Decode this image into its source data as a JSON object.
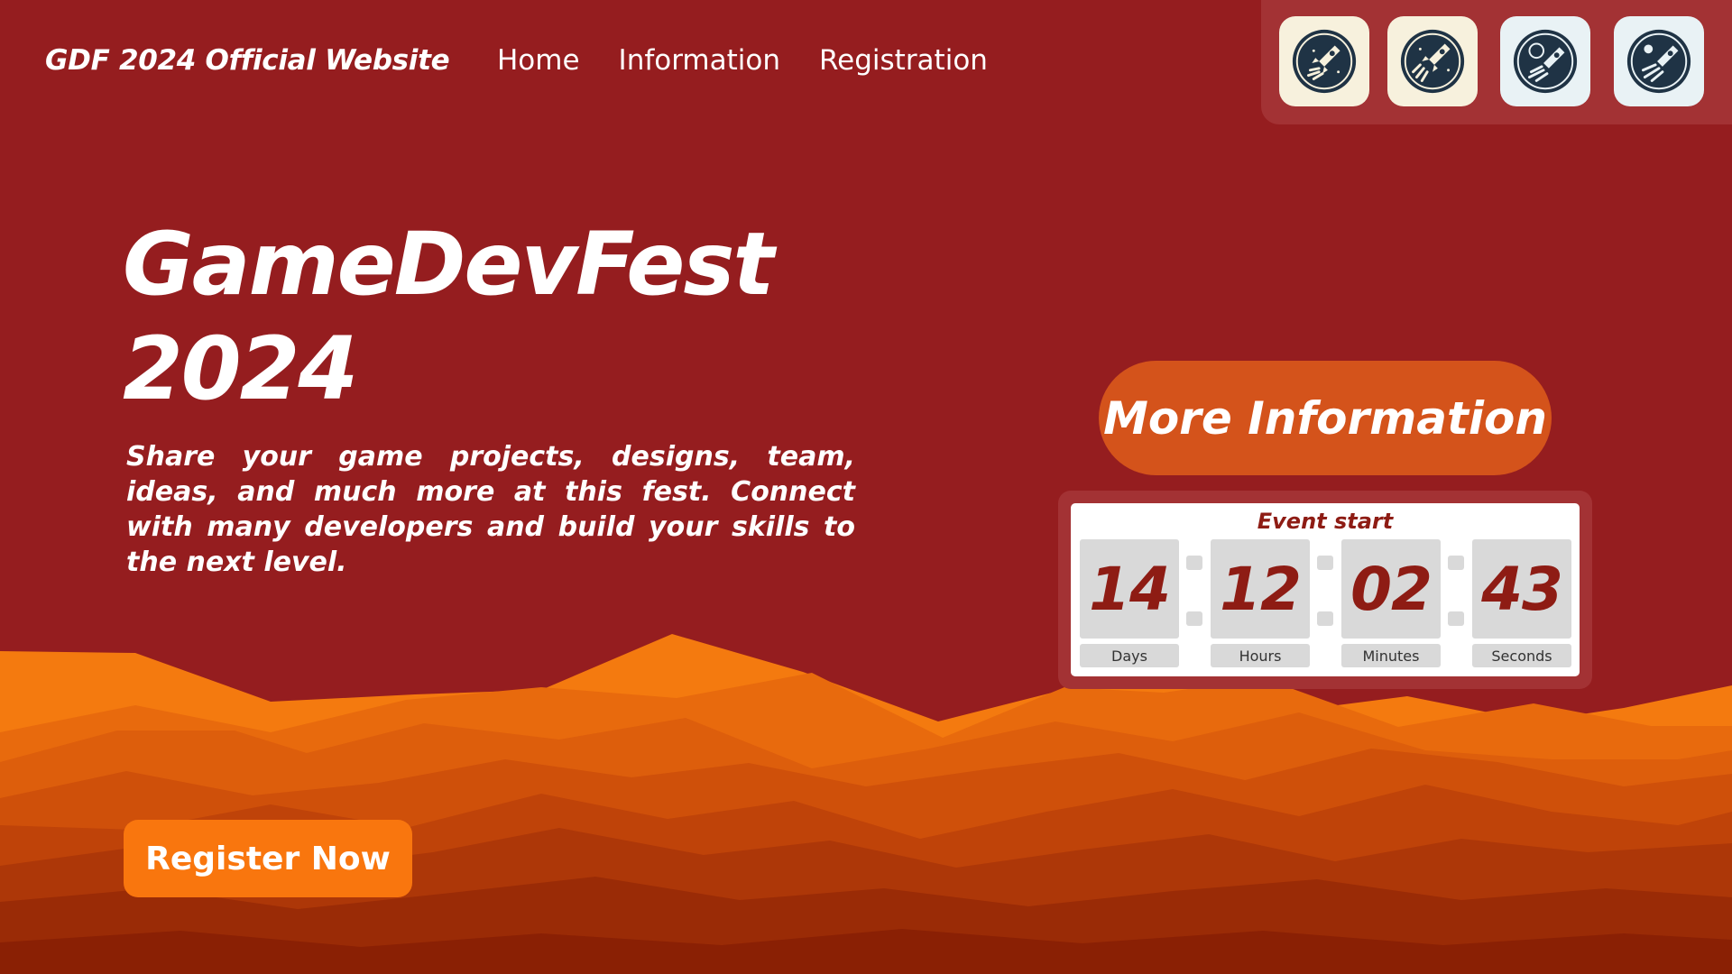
{
  "header": {
    "site_title": "GDF 2024 Official Website",
    "nav": [
      "Home",
      "Information",
      "Registration"
    ],
    "icons": [
      {
        "name": "rocket-badge-icon",
        "bg": "#f7f1dd"
      },
      {
        "name": "rocket-launch-icon",
        "bg": "#f7f1dd"
      },
      {
        "name": "rocket-planet-icon",
        "bg": "#e9f2f5"
      },
      {
        "name": "rocket-moon-icon",
        "bg": "#e9f2f5"
      }
    ]
  },
  "hero": {
    "title_line1": "GameDevFest",
    "title_line2": "2024",
    "description": "Share your game projects, designs, team, ideas, and much more at this fest. Connect with many developers and build your skills to the next level."
  },
  "buttons": {
    "more_info": "More Information",
    "register": "Register Now"
  },
  "countdown": {
    "title": "Event start",
    "units": [
      {
        "value": "14",
        "label": "Days"
      },
      {
        "value": "12",
        "label": "Hours"
      },
      {
        "value": "02",
        "label": "Minutes"
      },
      {
        "value": "43",
        "label": "Seconds"
      }
    ]
  },
  "colors": {
    "background": "#951d1f",
    "accent_orange": "#f9760e",
    "button_orange": "#d4531b",
    "countdown_text": "#8e1c14"
  }
}
